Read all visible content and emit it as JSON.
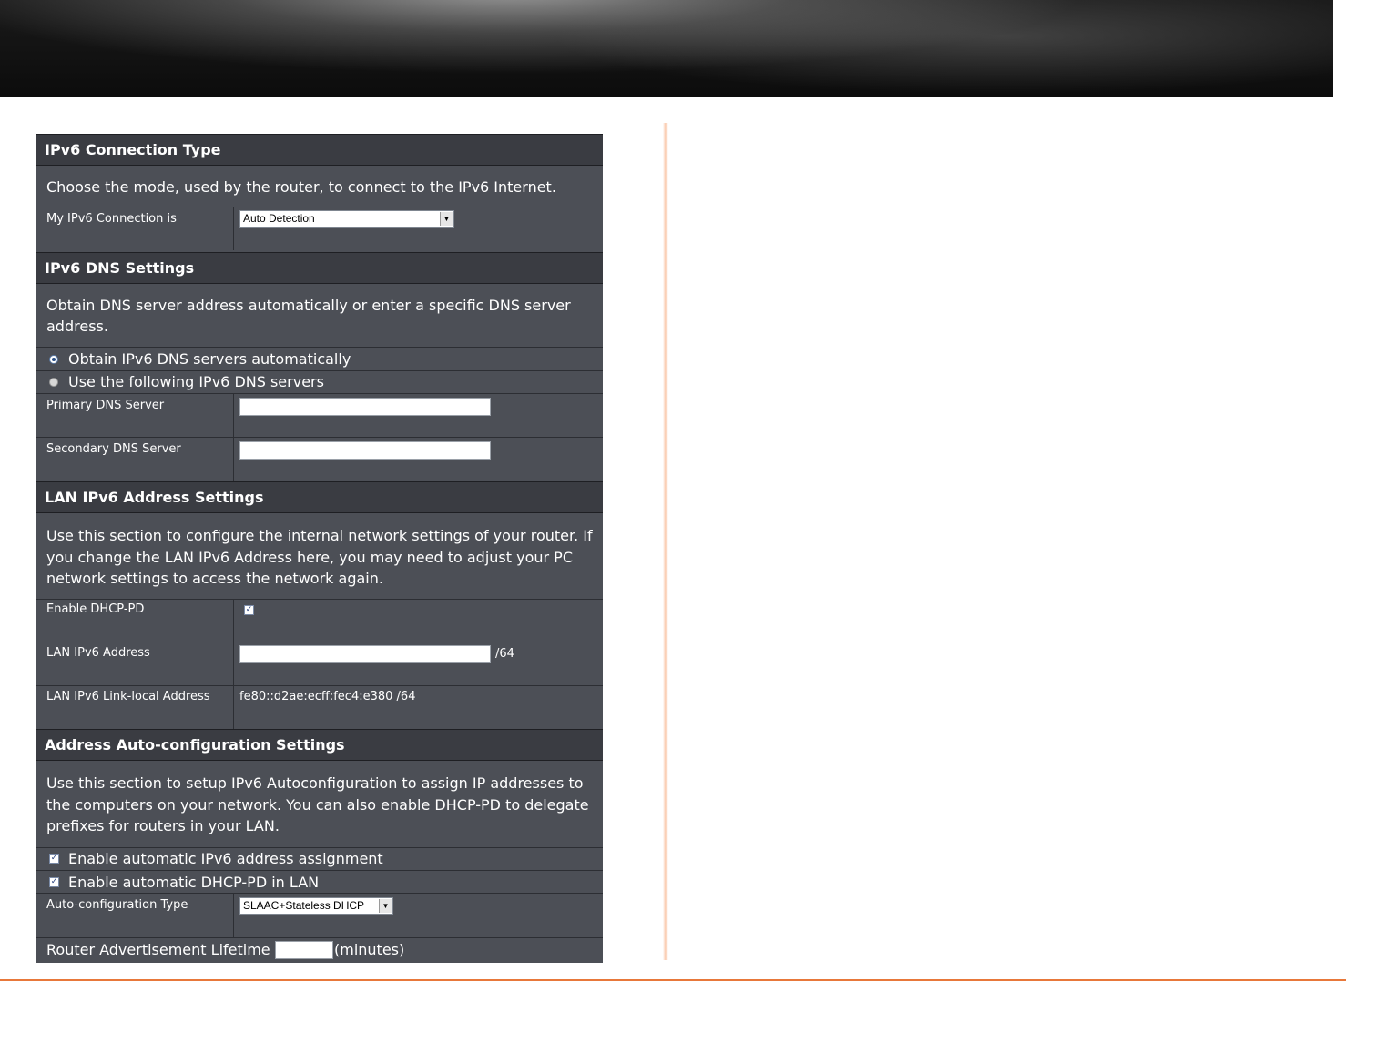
{
  "colors": {
    "panel_bg": "#4c4f56",
    "header_bg": "#3a3c42",
    "accent_line": "#e8783a"
  },
  "connection_type": {
    "title": "IPv6 Connection Type",
    "description": "Choose the mode, used by the router, to connect to the IPv6 Internet.",
    "my_connection_label": "My IPv6 Connection is",
    "my_connection_value": "Auto Detection"
  },
  "dns": {
    "title": "IPv6 DNS Settings",
    "description_line1": "Obtain DNS server address automatically or enter a specific DNS server",
    "description_line2": "address.",
    "option_auto": "Obtain IPv6 DNS servers automatically",
    "option_manual": "Use the following IPv6 DNS servers",
    "selected_option": "Obtain IPv6 DNS servers automatically",
    "primary_label": "Primary DNS Server",
    "primary_value": "",
    "secondary_label": "Secondary DNS Server",
    "secondary_value": ""
  },
  "lan": {
    "title": "LAN IPv6 Address Settings",
    "description_line1": "Use this section to configure the internal network settings of your router. If",
    "description_line2": "you change the LAN IPv6 Address here, you may need to adjust your PC",
    "description_line3": "network settings to access the network again.",
    "dhcp_pd_label": "Enable DHCP-PD",
    "dhcp_pd_checked": true,
    "address_label": "LAN IPv6 Address",
    "address_value": "",
    "prefix_suffix": "/64",
    "link_local_label": "LAN IPv6 Link-local Address",
    "link_local_value": "fe80::d2ae:ecff:fec4:e380 /64"
  },
  "autoconfig": {
    "title": "Address Auto-configuration Settings",
    "description_line1": "Use this section to setup IPv6 Autoconfiguration to assign IP addresses to",
    "description_line2": "the computers on your network. You can also enable DHCP-PD to delegate",
    "description_line3": "prefixes for routers in your LAN.",
    "enable_assignment_label": "Enable automatic IPv6 address assignment",
    "enable_assignment_checked": true,
    "enable_dhcp_pd_lan_label": "Enable automatic DHCP-PD in LAN",
    "enable_dhcp_pd_lan_checked": true,
    "type_label": "Auto-configuration Type",
    "type_value": "SLAAC+Stateless DHCP",
    "lifetime_label": "Router Advertisement Lifetime",
    "lifetime_value": "",
    "lifetime_unit": "(minutes)"
  },
  "icons": {
    "checkbox_mark": "✓",
    "dropdown_arrow": "▼"
  }
}
